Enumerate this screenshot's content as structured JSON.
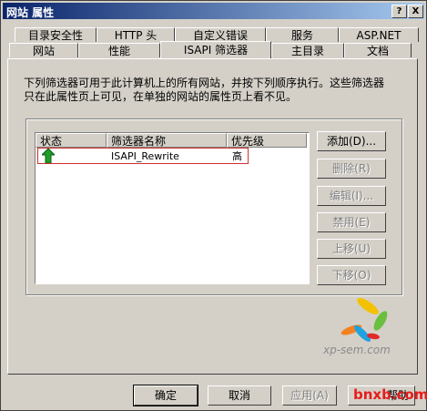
{
  "window": {
    "title": "网站 属性",
    "help_label": "?",
    "close_label": "X"
  },
  "tabs_back": [
    "目录安全性",
    "HTTP 头",
    "自定义错误",
    "服务",
    "ASP.NET"
  ],
  "tabs_front": [
    "网站",
    "性能",
    "ISAPI 筛选器",
    "主目录",
    "文档"
  ],
  "description": "下列筛选器可用于此计算机上的所有网站，并按下列顺序执行。这些筛选器只在此属性页上可见，在单独的网站的属性页上看不见。",
  "table": {
    "headers": [
      "状态",
      "筛选器名称",
      "优先级"
    ],
    "rows": [
      {
        "status_icon": "green-up-arrow-icon",
        "name": "ISAPI_Rewrite",
        "priority": "高"
      }
    ]
  },
  "side_buttons": {
    "add": "添加(D)...",
    "remove": "删除(R)",
    "edit": "编辑(I)...",
    "disable": "禁用(E)",
    "move_up": "上移(U)",
    "move_down": "下移(O)"
  },
  "bottom_buttons": {
    "ok": "确定",
    "cancel": "取消",
    "apply": "应用(A)",
    "help": "帮助"
  },
  "watermark": {
    "site": "xp-sem.com",
    "overlay": "bnxb.com"
  },
  "colors": {
    "title_start": "#0a246a",
    "title_end": "#a6caf0",
    "highlight": "#d03030",
    "watermark_overlay": "#e81b1b"
  }
}
